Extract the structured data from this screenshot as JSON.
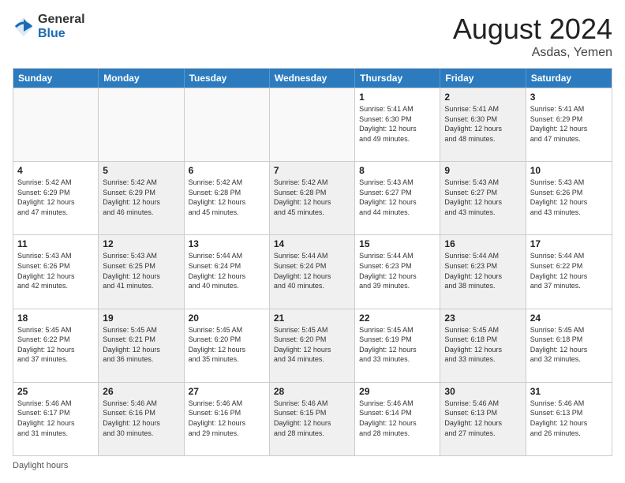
{
  "header": {
    "logo_general": "General",
    "logo_blue": "Blue",
    "month_title": "August 2024",
    "location": "Asdas, Yemen"
  },
  "weekdays": [
    "Sunday",
    "Monday",
    "Tuesday",
    "Wednesday",
    "Thursday",
    "Friday",
    "Saturday"
  ],
  "footer": {
    "daylight_label": "Daylight hours"
  },
  "rows": [
    [
      {
        "day": "",
        "info": "",
        "empty": true
      },
      {
        "day": "",
        "info": "",
        "empty": true
      },
      {
        "day": "",
        "info": "",
        "empty": true
      },
      {
        "day": "",
        "info": "",
        "empty": true
      },
      {
        "day": "1",
        "info": "Sunrise: 5:41 AM\nSunset: 6:30 PM\nDaylight: 12 hours\nand 49 minutes.",
        "empty": false,
        "shaded": false
      },
      {
        "day": "2",
        "info": "Sunrise: 5:41 AM\nSunset: 6:30 PM\nDaylight: 12 hours\nand 48 minutes.",
        "empty": false,
        "shaded": true
      },
      {
        "day": "3",
        "info": "Sunrise: 5:41 AM\nSunset: 6:29 PM\nDaylight: 12 hours\nand 47 minutes.",
        "empty": false,
        "shaded": false
      }
    ],
    [
      {
        "day": "4",
        "info": "Sunrise: 5:42 AM\nSunset: 6:29 PM\nDaylight: 12 hours\nand 47 minutes.",
        "empty": false,
        "shaded": false
      },
      {
        "day": "5",
        "info": "Sunrise: 5:42 AM\nSunset: 6:29 PM\nDaylight: 12 hours\nand 46 minutes.",
        "empty": false,
        "shaded": true
      },
      {
        "day": "6",
        "info": "Sunrise: 5:42 AM\nSunset: 6:28 PM\nDaylight: 12 hours\nand 45 minutes.",
        "empty": false,
        "shaded": false
      },
      {
        "day": "7",
        "info": "Sunrise: 5:42 AM\nSunset: 6:28 PM\nDaylight: 12 hours\nand 45 minutes.",
        "empty": false,
        "shaded": true
      },
      {
        "day": "8",
        "info": "Sunrise: 5:43 AM\nSunset: 6:27 PM\nDaylight: 12 hours\nand 44 minutes.",
        "empty": false,
        "shaded": false
      },
      {
        "day": "9",
        "info": "Sunrise: 5:43 AM\nSunset: 6:27 PM\nDaylight: 12 hours\nand 43 minutes.",
        "empty": false,
        "shaded": true
      },
      {
        "day": "10",
        "info": "Sunrise: 5:43 AM\nSunset: 6:26 PM\nDaylight: 12 hours\nand 43 minutes.",
        "empty": false,
        "shaded": false
      }
    ],
    [
      {
        "day": "11",
        "info": "Sunrise: 5:43 AM\nSunset: 6:26 PM\nDaylight: 12 hours\nand 42 minutes.",
        "empty": false,
        "shaded": false
      },
      {
        "day": "12",
        "info": "Sunrise: 5:43 AM\nSunset: 6:25 PM\nDaylight: 12 hours\nand 41 minutes.",
        "empty": false,
        "shaded": true
      },
      {
        "day": "13",
        "info": "Sunrise: 5:44 AM\nSunset: 6:24 PM\nDaylight: 12 hours\nand 40 minutes.",
        "empty": false,
        "shaded": false
      },
      {
        "day": "14",
        "info": "Sunrise: 5:44 AM\nSunset: 6:24 PM\nDaylight: 12 hours\nand 40 minutes.",
        "empty": false,
        "shaded": true
      },
      {
        "day": "15",
        "info": "Sunrise: 5:44 AM\nSunset: 6:23 PM\nDaylight: 12 hours\nand 39 minutes.",
        "empty": false,
        "shaded": false
      },
      {
        "day": "16",
        "info": "Sunrise: 5:44 AM\nSunset: 6:23 PM\nDaylight: 12 hours\nand 38 minutes.",
        "empty": false,
        "shaded": true
      },
      {
        "day": "17",
        "info": "Sunrise: 5:44 AM\nSunset: 6:22 PM\nDaylight: 12 hours\nand 37 minutes.",
        "empty": false,
        "shaded": false
      }
    ],
    [
      {
        "day": "18",
        "info": "Sunrise: 5:45 AM\nSunset: 6:22 PM\nDaylight: 12 hours\nand 37 minutes.",
        "empty": false,
        "shaded": false
      },
      {
        "day": "19",
        "info": "Sunrise: 5:45 AM\nSunset: 6:21 PM\nDaylight: 12 hours\nand 36 minutes.",
        "empty": false,
        "shaded": true
      },
      {
        "day": "20",
        "info": "Sunrise: 5:45 AM\nSunset: 6:20 PM\nDaylight: 12 hours\nand 35 minutes.",
        "empty": false,
        "shaded": false
      },
      {
        "day": "21",
        "info": "Sunrise: 5:45 AM\nSunset: 6:20 PM\nDaylight: 12 hours\nand 34 minutes.",
        "empty": false,
        "shaded": true
      },
      {
        "day": "22",
        "info": "Sunrise: 5:45 AM\nSunset: 6:19 PM\nDaylight: 12 hours\nand 33 minutes.",
        "empty": false,
        "shaded": false
      },
      {
        "day": "23",
        "info": "Sunrise: 5:45 AM\nSunset: 6:18 PM\nDaylight: 12 hours\nand 33 minutes.",
        "empty": false,
        "shaded": true
      },
      {
        "day": "24",
        "info": "Sunrise: 5:45 AM\nSunset: 6:18 PM\nDaylight: 12 hours\nand 32 minutes.",
        "empty": false,
        "shaded": false
      }
    ],
    [
      {
        "day": "25",
        "info": "Sunrise: 5:46 AM\nSunset: 6:17 PM\nDaylight: 12 hours\nand 31 minutes.",
        "empty": false,
        "shaded": false
      },
      {
        "day": "26",
        "info": "Sunrise: 5:46 AM\nSunset: 6:16 PM\nDaylight: 12 hours\nand 30 minutes.",
        "empty": false,
        "shaded": true
      },
      {
        "day": "27",
        "info": "Sunrise: 5:46 AM\nSunset: 6:16 PM\nDaylight: 12 hours\nand 29 minutes.",
        "empty": false,
        "shaded": false
      },
      {
        "day": "28",
        "info": "Sunrise: 5:46 AM\nSunset: 6:15 PM\nDaylight: 12 hours\nand 28 minutes.",
        "empty": false,
        "shaded": true
      },
      {
        "day": "29",
        "info": "Sunrise: 5:46 AM\nSunset: 6:14 PM\nDaylight: 12 hours\nand 28 minutes.",
        "empty": false,
        "shaded": false
      },
      {
        "day": "30",
        "info": "Sunrise: 5:46 AM\nSunset: 6:13 PM\nDaylight: 12 hours\nand 27 minutes.",
        "empty": false,
        "shaded": true
      },
      {
        "day": "31",
        "info": "Sunrise: 5:46 AM\nSunset: 6:13 PM\nDaylight: 12 hours\nand 26 minutes.",
        "empty": false,
        "shaded": false
      }
    ]
  ]
}
